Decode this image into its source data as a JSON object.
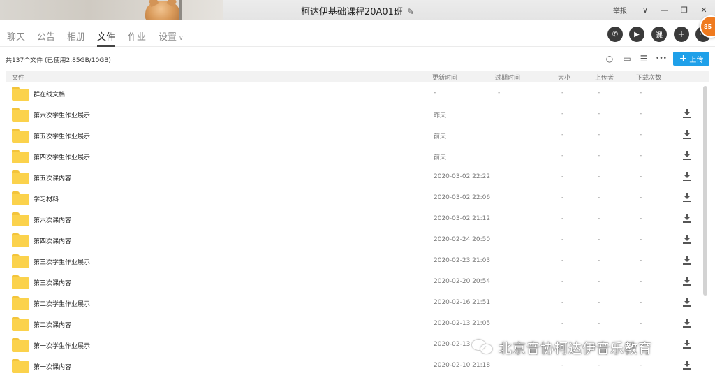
{
  "window": {
    "title": "柯达伊基础课程20A01班",
    "edit_icon": "✎",
    "report": "举报",
    "controls": {
      "dropdown": "∨",
      "minimize": "—",
      "restore": "❐",
      "close": "✕"
    },
    "badge": "85"
  },
  "tabs": [
    {
      "label": "聊天",
      "active": false
    },
    {
      "label": "公告",
      "active": false
    },
    {
      "label": "相册",
      "active": false
    },
    {
      "label": "文件",
      "active": true
    },
    {
      "label": "作业",
      "active": false
    },
    {
      "label": "设置",
      "active": false,
      "dropdown": "∨"
    }
  ],
  "actions": {
    "phone": "✆",
    "video": "▶",
    "class": "课",
    "add": "+",
    "more": "•••"
  },
  "files_toolbar": {
    "summary": "共137个文件 (已使用2.85GB/10GB)",
    "search_icon": "○",
    "storage_icon": "▭",
    "list_icon": "☰",
    "more_icon": "•••",
    "upload_label": "上传",
    "upload_plus": "+"
  },
  "columns": {
    "name": "文件",
    "updated": "更新时间",
    "expires": "过期时间",
    "size": "大小",
    "uploader": "上传者",
    "downloads": "下载次数"
  },
  "files": [
    {
      "name": "群在线文档",
      "updated": "-",
      "expires": "-",
      "size": "-",
      "uploader": "-",
      "downloads": "-",
      "downloadable": false
    },
    {
      "name": "第六次学生作业展示",
      "updated": "昨天",
      "expires": "",
      "size": "-",
      "uploader": "-",
      "downloads": "-",
      "downloadable": true
    },
    {
      "name": "第五次学生作业展示",
      "updated": "前天",
      "expires": "",
      "size": "-",
      "uploader": "-",
      "downloads": "-",
      "downloadable": true
    },
    {
      "name": "第四次学生作业展示",
      "updated": "前天",
      "expires": "",
      "size": "-",
      "uploader": "-",
      "downloads": "-",
      "downloadable": true
    },
    {
      "name": "第五次课内容",
      "updated": "2020-03-02 22:22",
      "expires": "",
      "size": "-",
      "uploader": "-",
      "downloads": "-",
      "downloadable": true
    },
    {
      "name": "学习材料",
      "updated": "2020-03-02 22:06",
      "expires": "",
      "size": "-",
      "uploader": "-",
      "downloads": "-",
      "downloadable": true
    },
    {
      "name": "第六次课内容",
      "updated": "2020-03-02 21:12",
      "expires": "",
      "size": "-",
      "uploader": "-",
      "downloads": "-",
      "downloadable": true
    },
    {
      "name": "第四次课内容",
      "updated": "2020-02-24 20:50",
      "expires": "",
      "size": "-",
      "uploader": "-",
      "downloads": "-",
      "downloadable": true
    },
    {
      "name": "第三次学生作业展示",
      "updated": "2020-02-23 21:03",
      "expires": "",
      "size": "-",
      "uploader": "-",
      "downloads": "-",
      "downloadable": true
    },
    {
      "name": "第三次课内容",
      "updated": "2020-02-20 20:54",
      "expires": "",
      "size": "-",
      "uploader": "-",
      "downloads": "-",
      "downloadable": true
    },
    {
      "name": "第二次学生作业展示",
      "updated": "2020-02-16 21:51",
      "expires": "",
      "size": "-",
      "uploader": "-",
      "downloads": "-",
      "downloadable": true
    },
    {
      "name": "第二次课内容",
      "updated": "2020-02-13 21:05",
      "expires": "",
      "size": "-",
      "uploader": "-",
      "downloads": "-",
      "downloadable": true
    },
    {
      "name": "第一次学生作业展示",
      "updated": "2020-02-13",
      "expires": "",
      "size": "-",
      "uploader": "-",
      "downloads": "-",
      "downloadable": true
    },
    {
      "name": "第一次课内容",
      "updated": "2020-02-10 21:18",
      "expires": "",
      "size": "-",
      "uploader": "-",
      "downloads": "-",
      "downloadable": true
    }
  ],
  "watermark": {
    "text": "北京音协柯达伊音乐教育"
  },
  "colors": {
    "accent": "#1fa0e9",
    "folder": "#fbd24c",
    "badge": "#ef7a1e"
  }
}
